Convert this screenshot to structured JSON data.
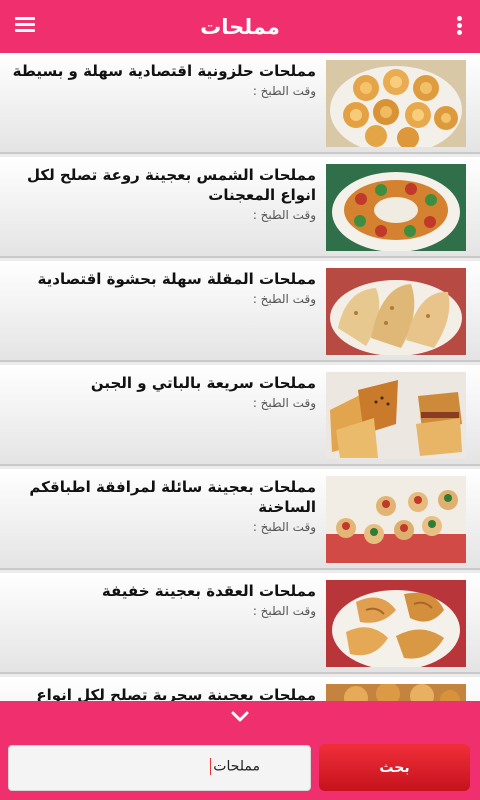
{
  "appbar": {
    "title": "مملحات",
    "menu_icon": "menu-icon",
    "overflow_icon": "more-vert-icon"
  },
  "recipes": [
    {
      "title": "مملحات حلزونية اقتصادية سهلة و بسيطة",
      "cook_time": "وقت الطبخ :"
    },
    {
      "title": "مملحات الشمس بعجينة روعة تصلح لكل انواع المعجنات",
      "cook_time": "وقت الطبخ :"
    },
    {
      "title": "مملحات المقلة سهلة بحشوة اقتصادية",
      "cook_time": "وقت الطبخ :"
    },
    {
      "title": "مملحات سريعة بالباتي و الجبن",
      "cook_time": "وقت الطبخ :"
    },
    {
      "title": "مملحات بعجينة سائلة لمرافقة اطباقكم الساخنة",
      "cook_time": "وقت الطبخ :"
    },
    {
      "title": "مملحات العقدة بعجينة خفيفة",
      "cook_time": "وقت الطبخ :"
    },
    {
      "title": "مملحات بعجينة سحرية تصلح لكل انواع",
      "cook_time": ""
    }
  ],
  "footer": {
    "expand_icon": "chevron-down-icon",
    "search_value": "مملحات",
    "search_button": "بحث"
  },
  "colors": {
    "primary": "#f0306e",
    "button": "#d81b25"
  }
}
